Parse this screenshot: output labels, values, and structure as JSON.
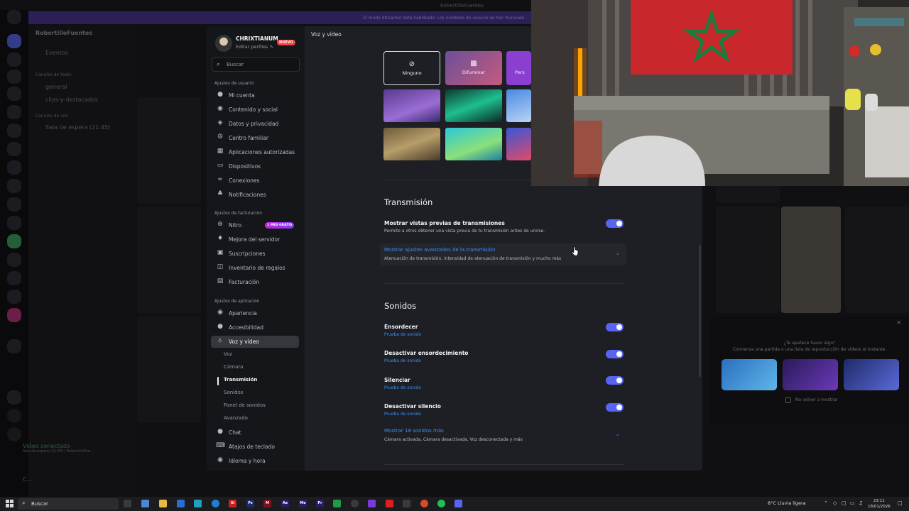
{
  "window": {
    "title": "RobertilloFuentes",
    "streamer_notice": "El modo Streamer está habilitado. Los nombres de usuario se han truncado."
  },
  "background": {
    "server_name": "RobertilloFuentes",
    "channels": [
      "Eventos",
      "Canales de texto",
      "general",
      "clips-y-destacados",
      "Canales de voz",
      "Sala de espera (21:45)"
    ],
    "voice_status": "Vídeo conectado",
    "voice_channel": "Sala de espera (21:45) / RobertilloFue...",
    "user_short": "C..."
  },
  "settings": {
    "profile": {
      "name": "CHRIXTIANUM",
      "edit_label": "Editar perfiles ✎",
      "badge": "NUEVO"
    },
    "search_placeholder": "Buscar",
    "sections": {
      "user": "Ajustes de usuario",
      "billing": "Ajustes de facturación",
      "app": "Ajustes de aplicación"
    },
    "user_items": [
      {
        "label": "Mi cuenta",
        "icon": "person-icon"
      },
      {
        "label": "Contenido y social",
        "icon": "globe-icon"
      },
      {
        "label": "Datos y privacidad",
        "icon": "shield-icon"
      },
      {
        "label": "Centro familiar",
        "icon": "family-icon"
      },
      {
        "label": "Aplicaciones autorizadas",
        "icon": "apps-icon"
      },
      {
        "label": "Dispositivos",
        "icon": "devices-icon"
      },
      {
        "label": "Conexiones",
        "icon": "link-icon"
      },
      {
        "label": "Notificaciones",
        "icon": "bell-icon"
      }
    ],
    "billing_items": [
      {
        "label": "Nitro",
        "icon": "nitro-icon"
      },
      {
        "label": "Mejora del servidor",
        "icon": "boost-icon"
      },
      {
        "label": "Suscripciones",
        "icon": "subscriptions-icon"
      },
      {
        "label": "Inventario de regalos",
        "icon": "gift-icon"
      },
      {
        "label": "Facturación",
        "icon": "billing-icon"
      }
    ],
    "nitro_badge": "1 MES GRATIS",
    "app_items": [
      {
        "label": "Apariencia",
        "icon": "palette-icon"
      },
      {
        "label": "Accesibilidad",
        "icon": "accessibility-icon"
      },
      {
        "label": "Voz y vídeo",
        "icon": "microphone-icon"
      }
    ],
    "voice_subitems": [
      "Voz",
      "Cámara",
      "Transmisión",
      "Sonidos",
      "Panel de sonidos",
      "Avanzado"
    ],
    "more_items": [
      {
        "label": "Chat",
        "icon": "chat-icon"
      },
      {
        "label": "Atajos de teclado",
        "icon": "keyboard-icon"
      },
      {
        "label": "Idioma y hora",
        "icon": "language-icon"
      }
    ],
    "page_title": "Voz y vídeo",
    "backgrounds": {
      "none_label": "Ninguno",
      "blur_label": "Difuminar",
      "custom_label": "Pers"
    },
    "transmission": {
      "heading": "Transmisión",
      "preview_title": "Mostrar vistas previas de transmisiones",
      "preview_desc": "Permite a otros obtener una vista previa de tu transmisión antes de unirse.",
      "preview_on": true,
      "advanced_title": "Mostrar ajustes avanzados de la transmisión",
      "advanced_desc": "Atenuación de transmisión, intensidad de atenuación de transmisión y mucho más"
    },
    "sounds": {
      "heading": "Sonidos",
      "test_label": "Prueba de sonido",
      "items": [
        {
          "title": "Ensordecer",
          "on": true
        },
        {
          "title": "Desactivar ensordecimiento",
          "on": true
        },
        {
          "title": "Silenciar",
          "on": true
        },
        {
          "title": "Desactivar silencio",
          "on": true
        }
      ],
      "more_title": "Mostrar 18 sonidos más",
      "more_desc": "Cámara activada, Cámara desactivada, Voz desconectada y más"
    }
  },
  "activity_panel": {
    "line1": "¿Te apetece hacer algo?",
    "line2": "Comienza una partida o una lista de reproducción de vídeos al instante.",
    "dont_show": "No volver a mostrar"
  },
  "taskbar": {
    "search_label": "Buscar",
    "weather": "8°C  Lluvia ligera",
    "time": "23:11",
    "date": "18/01/2026"
  },
  "colors": {
    "accent": "#5865f2",
    "link": "#3c8ff5",
    "modal_bg": "#1e1f24",
    "sidebar_bg": "#15161a"
  }
}
